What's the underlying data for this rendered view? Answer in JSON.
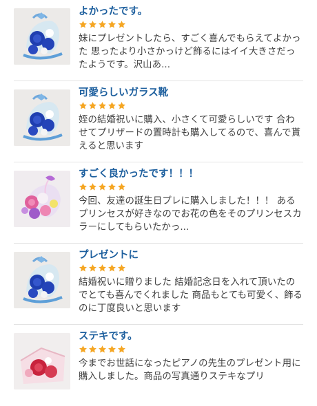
{
  "colors": {
    "title": "#1d5f9e",
    "star": "#f5a623",
    "text": "#3f3f3f",
    "divider": "#e3e3e3"
  },
  "reviews": [
    {
      "title": "よかったです。",
      "rating": 5,
      "body": "妹にプレゼントしたら、すごく喜んでもらえてよかった 思ったより小さかっけど飾るにはイイ大きさだったようです。沢山あ...",
      "image": "blue-rose-glass-shoe"
    },
    {
      "title": "可愛らしいガラス靴",
      "rating": 5,
      "body": "姪の結婚祝いに購入、小さくて可愛らしいです 合わせてプリザードの置時計も購入してるので、喜んで貰えると思います",
      "image": "blue-rose-glass-shoe"
    },
    {
      "title": "すごく良かったです！！！",
      "rating": 5,
      "body": "今回、友達の誕生日プレに購入しました！！！ あるプリンセスが好きなのでお花の色をそのプリンセスカラーにしてもらいたかっ...",
      "image": "pink-rose-glass-shoe"
    },
    {
      "title": "プレゼントに",
      "rating": 5,
      "body": "結婚祝いに贈りました 結婚記念日を入れて頂いたのでとても喜んでくれました 商品もとても可愛く、飾るのに丁度良いと思います",
      "image": "blue-rose-glass-shoe"
    },
    {
      "title": "ステキです。",
      "rating": 5,
      "body": "今までお世話になったピアノの先生のプレゼント用に購入しました。商品の写真通りステキなプリ",
      "image": "red-rose-glass-box"
    }
  ]
}
